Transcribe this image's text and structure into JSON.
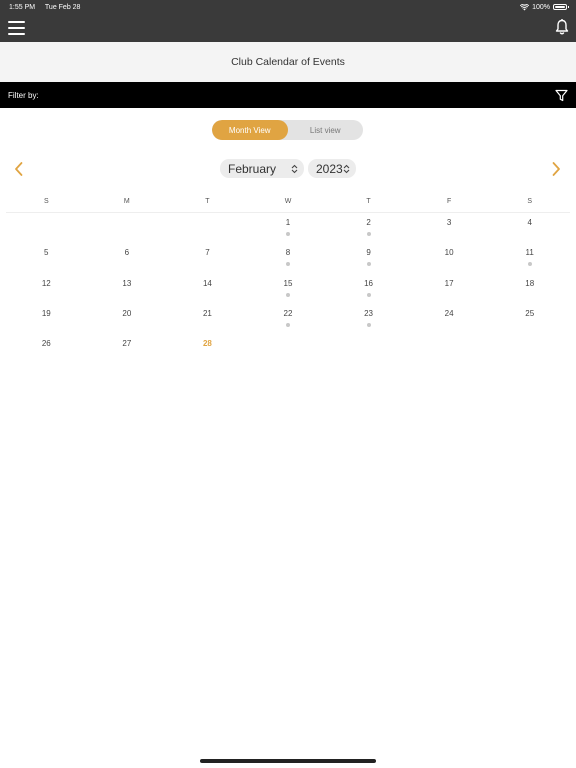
{
  "status": {
    "time": "1:55 PM",
    "date": "Tue Feb 28",
    "battery": "100%",
    "battery_level_percent": 100
  },
  "header": {
    "title": "Club Calendar of Events"
  },
  "filter": {
    "label": "Filter by:"
  },
  "view_toggle": {
    "month": "Month View",
    "list": "List view",
    "selected": "month"
  },
  "picker": {
    "month": "February",
    "year": "2023"
  },
  "weekdays": [
    "S",
    "M",
    "T",
    "W",
    "T",
    "F",
    "S"
  ],
  "calendar": {
    "leading_blanks": 3,
    "days": [
      {
        "d": "1",
        "dot": true
      },
      {
        "d": "2",
        "dot": true
      },
      {
        "d": "3",
        "dot": false
      },
      {
        "d": "4",
        "dot": false
      },
      {
        "d": "5",
        "dot": false
      },
      {
        "d": "6",
        "dot": false
      },
      {
        "d": "7",
        "dot": false
      },
      {
        "d": "8",
        "dot": true
      },
      {
        "d": "9",
        "dot": true
      },
      {
        "d": "10",
        "dot": false
      },
      {
        "d": "11",
        "dot": true
      },
      {
        "d": "12",
        "dot": false
      },
      {
        "d": "13",
        "dot": false
      },
      {
        "d": "14",
        "dot": false
      },
      {
        "d": "15",
        "dot": true
      },
      {
        "d": "16",
        "dot": true
      },
      {
        "d": "17",
        "dot": false
      },
      {
        "d": "18",
        "dot": false
      },
      {
        "d": "19",
        "dot": false
      },
      {
        "d": "20",
        "dot": false
      },
      {
        "d": "21",
        "dot": false
      },
      {
        "d": "22",
        "dot": true
      },
      {
        "d": "23",
        "dot": true
      },
      {
        "d": "24",
        "dot": false
      },
      {
        "d": "25",
        "dot": false
      },
      {
        "d": "26",
        "dot": false
      },
      {
        "d": "27",
        "dot": false
      },
      {
        "d": "28",
        "dot": false,
        "today": true
      }
    ]
  },
  "colors": {
    "accent": "#e0a442",
    "nav_bg": "#3a3a3a",
    "filter_bg": "#000000",
    "dot": "#c8c8c8"
  }
}
